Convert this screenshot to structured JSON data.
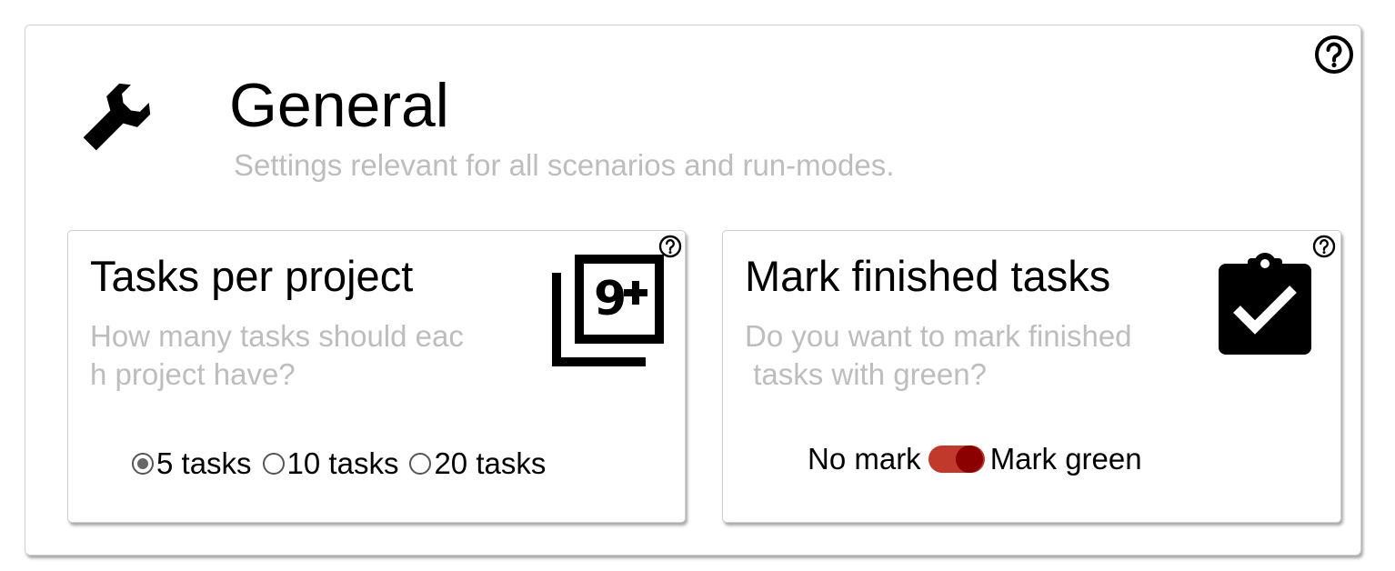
{
  "header": {
    "title": "General",
    "subtitle": "Settings relevant for all scenarios and run-modes.",
    "icon": "wrench-icon",
    "help_icon": "help-icon"
  },
  "cards": [
    {
      "title": "Tasks per project",
      "description": "How many tasks should eac\nh project have?",
      "icon": "filter-9-plus-icon",
      "help_icon": "help-icon",
      "control": {
        "type": "radio",
        "options": [
          {
            "label": "5 tasks",
            "selected": true
          },
          {
            "label": "10 tasks",
            "selected": false
          },
          {
            "label": "20 tasks",
            "selected": false
          }
        ]
      }
    },
    {
      "title": "Mark finished tasks",
      "description": "Do you want to mark finished\n tasks with green?",
      "icon": "clipboard-check-icon",
      "help_icon": "help-icon",
      "control": {
        "type": "toggle",
        "off_label": "No mark",
        "on_label": "Mark green",
        "value": true
      }
    }
  ],
  "colors": {
    "toggle_track": "#c0392b",
    "toggle_knob": "#8b0000",
    "muted_text": "#bdbdbd"
  }
}
